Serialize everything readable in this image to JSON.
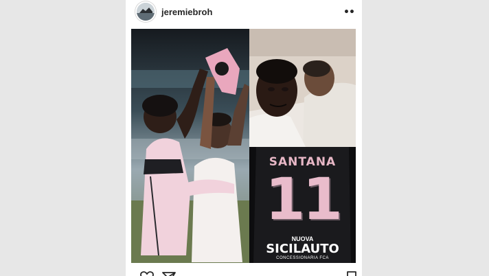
{
  "post": {
    "username": "jeremiebroh",
    "avatar_icon": "profile-avatar",
    "more_label": "••"
  },
  "media": {
    "jersey": {
      "name": "SANTANA",
      "number": "11",
      "sponsor_top": "NUOVA",
      "sponsor_main": "SICILAUTO",
      "sponsor_sub": "CONCESSIONARIA FCA"
    }
  },
  "actions": {
    "icons": [
      "heart-icon",
      "share-icon",
      "bookmark-icon"
    ]
  },
  "colors": {
    "background": "#e7e7e7",
    "card": "#ffffff",
    "jersey_pink": "#e9bccb"
  }
}
